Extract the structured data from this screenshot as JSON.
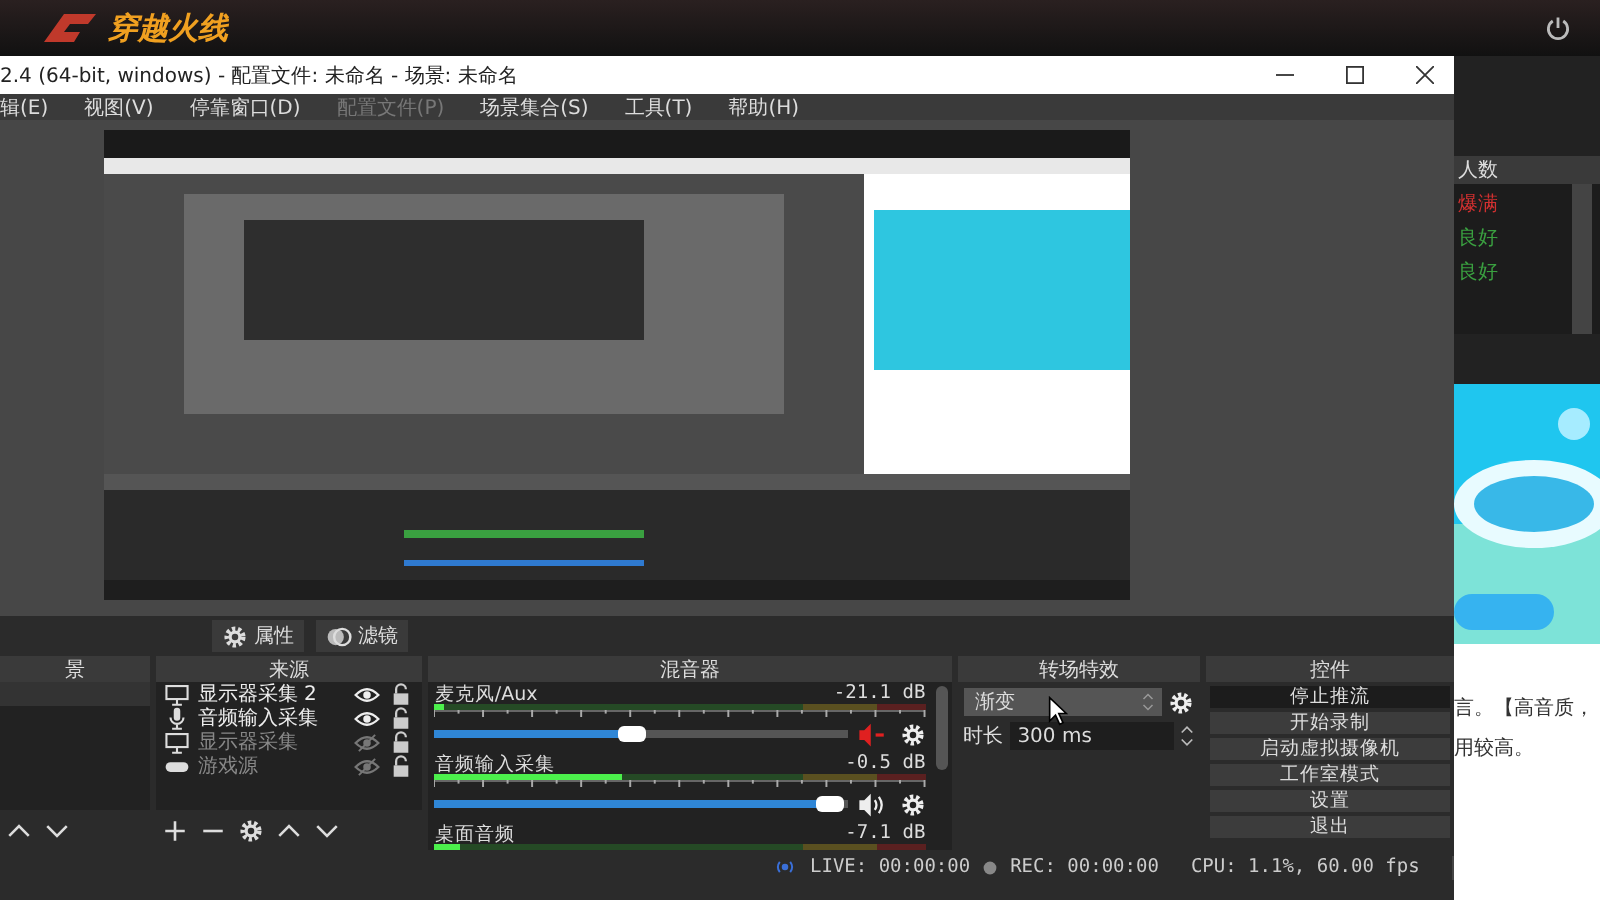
{
  "launcher": {
    "logo": "穿越火线",
    "server_header": "人数",
    "server_rows": [
      {
        "status": "爆满",
        "color": "#d03030"
      },
      {
        "status": "良好",
        "color": "#3aa040"
      },
      {
        "status": "良好",
        "color": "#3aa040"
      }
    ],
    "notice_lines": [
      "言。【高音质，",
      "用较高。"
    ]
  },
  "window": {
    "title": "2.4 (64-bit, windows) - 配置文件: 未命名 - 场景: 未命名"
  },
  "menu": [
    {
      "label": "辑(E)",
      "disabled": false
    },
    {
      "label": "视图(V)",
      "disabled": false
    },
    {
      "label": "停靠窗口(D)",
      "disabled": false
    },
    {
      "label": "配置文件(P)",
      "disabled": true
    },
    {
      "label": "场景集合(S)",
      "disabled": false
    },
    {
      "label": "工具(T)",
      "disabled": false
    },
    {
      "label": "帮助(H)",
      "disabled": false
    }
  ],
  "toolbar": [
    "属性",
    "滤镜"
  ],
  "scenes": {
    "title": "景"
  },
  "sources": {
    "title": "来源",
    "items": [
      {
        "name": "显示器采集 2",
        "kind": "display",
        "visible": true
      },
      {
        "name": "音频输入采集",
        "kind": "mic",
        "visible": true
      },
      {
        "name": "显示器采集",
        "kind": "display",
        "visible": false
      },
      {
        "name": "游戏源",
        "kind": "game",
        "visible": false
      }
    ]
  },
  "mixer": {
    "title": "混音器",
    "channels": [
      {
        "name": "麦克风/Aux",
        "reading": "-21.1 dB",
        "meter": {
          "level": 0.02
        },
        "level": 0.48,
        "muted": true
      },
      {
        "name": "音频输入采集",
        "reading": "-0.5 dB",
        "meter": {
          "level": 0.38
        },
        "level": 0.96,
        "muted": false
      },
      {
        "name": "桌面音频",
        "reading": "-7.1 dB",
        "meter": {
          "level": 0.05
        }
      }
    ]
  },
  "transitions": {
    "title": "转场特效",
    "selected": "渐变",
    "duration_label": "时长",
    "duration": "300 ms"
  },
  "controls": {
    "title": "控件",
    "buttons": [
      {
        "label": "停止推流",
        "active": true
      },
      {
        "label": "开始录制",
        "active": false
      },
      {
        "label": "启动虚拟摄像机",
        "active": false
      },
      {
        "label": "工作室模式",
        "active": false
      },
      {
        "label": "设置",
        "active": false
      },
      {
        "label": "退出",
        "active": false
      }
    ]
  },
  "status_bar": {
    "live": "LIVE: 00:00:00",
    "rec": "REC: 00:00:00",
    "cpu": "CPU: 1.1%, 60.00 fps"
  }
}
